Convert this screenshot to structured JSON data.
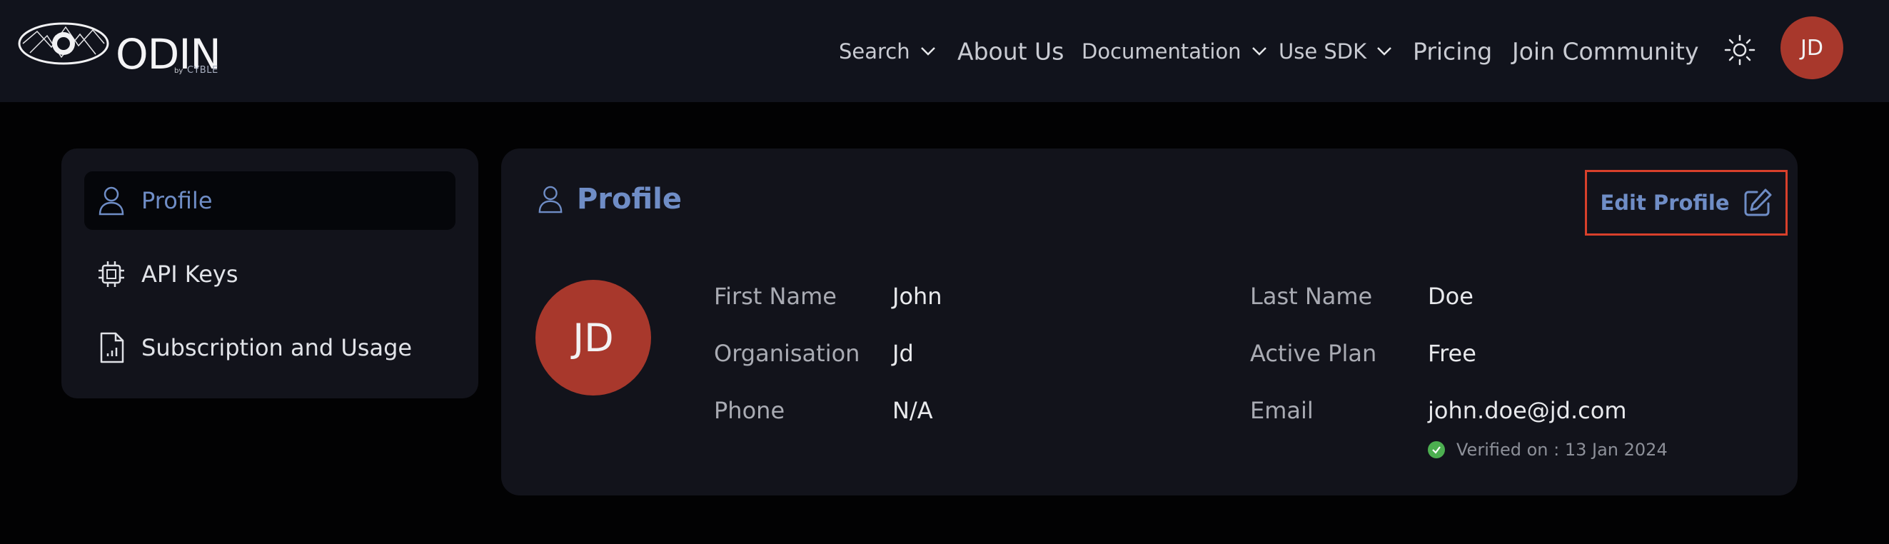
{
  "header": {
    "logo": {
      "word": "ODIN",
      "by": "by",
      "brand": "CYBLE"
    },
    "nav": [
      {
        "label": "Search",
        "dropdown": true
      },
      {
        "label": "About Us",
        "dropdown": false
      },
      {
        "label": "Documentation",
        "dropdown": true
      },
      {
        "label": "Use SDK",
        "dropdown": true
      },
      {
        "label": "Pricing",
        "dropdown": false
      },
      {
        "label": "Join Community",
        "dropdown": false
      }
    ],
    "theme_icon": "sun-icon",
    "avatar_initials": "JD"
  },
  "sidebar": {
    "items": [
      {
        "label": "Profile",
        "icon": "user-icon",
        "active": true
      },
      {
        "label": "API Keys",
        "icon": "chip-icon",
        "active": false
      },
      {
        "label": "Subscription and Usage",
        "icon": "file-chart-icon",
        "active": false
      }
    ]
  },
  "profile": {
    "title": "Profile",
    "edit_label": "Edit Profile",
    "avatar_initials": "JD",
    "fields": {
      "first_name": {
        "label": "First Name",
        "value": "John"
      },
      "last_name": {
        "label": "Last Name",
        "value": "Doe"
      },
      "organisation": {
        "label": "Organisation",
        "value": "Jd"
      },
      "active_plan": {
        "label": "Active Plan",
        "value": "Free"
      },
      "phone": {
        "label": "Phone",
        "value": "N/A"
      },
      "email": {
        "label": "Email",
        "value": "john.doe@jd.com"
      }
    },
    "verified_text": "Verified on : 13 Jan 2024"
  },
  "colors": {
    "accent": "#6f8dc6",
    "avatar_bg": "#a8382c",
    "highlight_border": "#d8402b",
    "verified_green": "#4caf50"
  }
}
